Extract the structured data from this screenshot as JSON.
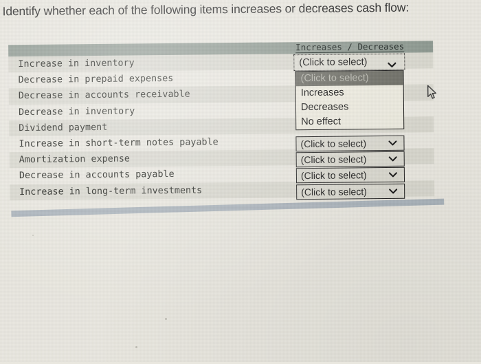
{
  "prompt": "Identify whether each of the following items increases or decreases cash flow:",
  "table": {
    "column_header": "Increases / Decreases",
    "items": [
      "Increase in inventory",
      "Decrease in prepaid expenses",
      "Decrease in accounts receivable",
      "Decrease in inventory",
      "Dividend payment",
      "Increase in short-term notes payable",
      "Amortization expense",
      "Decrease in accounts payable",
      "Increase in long-term investments"
    ]
  },
  "selects": {
    "placeholder": "(Click to select)",
    "open_index": 0,
    "open_value": "(Click to select)",
    "options": [
      "(Click to select)",
      "Increases",
      "Decreases",
      "No effect"
    ],
    "highlighted_option": "(Click to select)",
    "collapsed_values": [
      "(Click to select)",
      "(Click to select)",
      "(Click to select)",
      "(Click to select)"
    ]
  },
  "icons": {
    "chevron": "chevron-down-icon",
    "cursor": "mouse-pointer-icon"
  },
  "colors": {
    "page_background": "#e9e7df",
    "header_band": "#8f9a92",
    "row_stripe": "#969b8c",
    "select_background": "#d9d8cf",
    "dropdown_background": "#eceade",
    "highlight_background": "#6e6e66",
    "highlight_text": "#b9b9b0",
    "bottom_rule": "#a6b0b8",
    "text": "#22241f"
  }
}
